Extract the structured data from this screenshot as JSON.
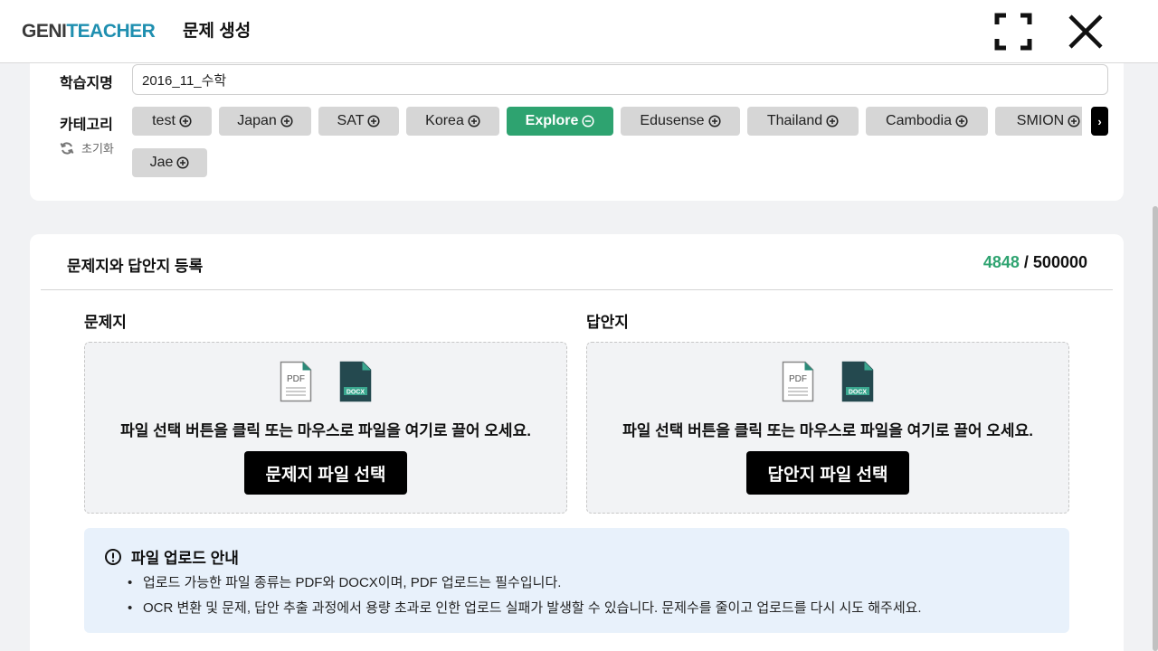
{
  "header": {
    "logo_part1": "GENI",
    "logo_part2": "TEACHER",
    "title": "문제 생성"
  },
  "settings": {
    "name_label": "학습지명",
    "name_value": "2016_11_수학",
    "category_label": "카테고리",
    "reset_label": "초기화",
    "categories": [
      {
        "label": "test",
        "active": false
      },
      {
        "label": "Japan",
        "active": false
      },
      {
        "label": "SAT",
        "active": false
      },
      {
        "label": "Korea",
        "active": false
      },
      {
        "label": "Explore",
        "active": true
      },
      {
        "label": "Edusense",
        "active": false
      },
      {
        "label": "Thailand",
        "active": false
      },
      {
        "label": "Cambodia",
        "active": false
      },
      {
        "label": "SMION",
        "active": false
      },
      {
        "label": "Jae",
        "active": false
      }
    ],
    "next_arrow": "›"
  },
  "register": {
    "title": "문제지와 답안지 등록",
    "count_used": "4848",
    "count_sep": " / ",
    "count_total": "500000",
    "question": {
      "label": "문제지",
      "drop_text": "파일 선택 버튼을 클릭 또는 마우스로 파일을 여기로 끌어 오세요.",
      "button": "문제지 파일 선택"
    },
    "answer": {
      "label": "답안지",
      "drop_text": "파일 선택 버튼을 클릭 또는 마우스로 파일을 여기로 끌어 오세요.",
      "button": "답안지 파일 선택"
    },
    "file_icons": {
      "pdf": "PDF",
      "docx": "DOCX"
    }
  },
  "notice": {
    "title": "파일 업로드 안내",
    "items": [
      "업로드 가능한 파일 종류는 PDF와 DOCX이며, PDF 업로드는 필수입니다.",
      "OCR 변환 및 문제, 답안 추출 과정에서 용량 초과로 인한 업로드 실패가 발생할 수 있습니다. 문제수를 줄이고 업로드를 다시 시도 해주세요."
    ]
  },
  "colors": {
    "accent_green": "#2ea370",
    "logo_blue": "#1f8fb0",
    "notice_bg": "#e8f1fb"
  }
}
